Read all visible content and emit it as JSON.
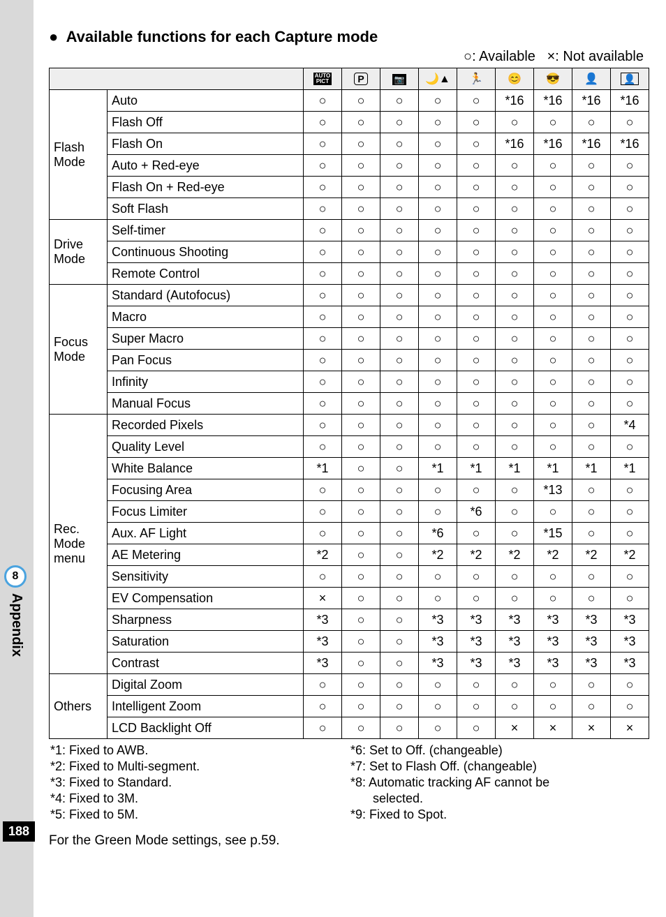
{
  "side": {
    "chapter": "8",
    "label": "Appendix",
    "page": "188"
  },
  "heading": "Available functions for each Capture mode",
  "legend_available": "○: Available",
  "legend_notavailable": "×: Not available",
  "footer_note": "For the Green Mode settings, see p.59.",
  "icons": [
    "AUTO PICT",
    "P",
    "Tv-like",
    "Night",
    "Sport",
    "Face1",
    "Face2",
    "Face3",
    "Frame"
  ],
  "groups": [
    {
      "cat": "Flash Mode",
      "rows": [
        {
          "item": "Auto",
          "v": [
            "○",
            "○",
            "○",
            "○",
            "○",
            "*16",
            "*16",
            "*16",
            "*16"
          ]
        },
        {
          "item": "Flash Off",
          "v": [
            "○",
            "○",
            "○",
            "○",
            "○",
            "○",
            "○",
            "○",
            "○"
          ]
        },
        {
          "item": "Flash On",
          "v": [
            "○",
            "○",
            "○",
            "○",
            "○",
            "*16",
            "*16",
            "*16",
            "*16"
          ]
        },
        {
          "item": "Auto + Red-eye",
          "v": [
            "○",
            "○",
            "○",
            "○",
            "○",
            "○",
            "○",
            "○",
            "○"
          ]
        },
        {
          "item": "Flash On + Red-eye",
          "v": [
            "○",
            "○",
            "○",
            "○",
            "○",
            "○",
            "○",
            "○",
            "○"
          ]
        },
        {
          "item": "Soft Flash",
          "v": [
            "○",
            "○",
            "○",
            "○",
            "○",
            "○",
            "○",
            "○",
            "○"
          ]
        }
      ]
    },
    {
      "cat": "Drive Mode",
      "rows": [
        {
          "item": "Self-timer",
          "v": [
            "○",
            "○",
            "○",
            "○",
            "○",
            "○",
            "○",
            "○",
            "○"
          ]
        },
        {
          "item": "Continuous Shooting",
          "v": [
            "○",
            "○",
            "○",
            "○",
            "○",
            "○",
            "○",
            "○",
            "○"
          ]
        },
        {
          "item": "Remote Control",
          "v": [
            "○",
            "○",
            "○",
            "○",
            "○",
            "○",
            "○",
            "○",
            "○"
          ]
        }
      ]
    },
    {
      "cat": "Focus Mode",
      "rows": [
        {
          "item": "Standard (Autofocus)",
          "v": [
            "○",
            "○",
            "○",
            "○",
            "○",
            "○",
            "○",
            "○",
            "○"
          ]
        },
        {
          "item": "Macro",
          "v": [
            "○",
            "○",
            "○",
            "○",
            "○",
            "○",
            "○",
            "○",
            "○"
          ]
        },
        {
          "item": "Super Macro",
          "v": [
            "○",
            "○",
            "○",
            "○",
            "○",
            "○",
            "○",
            "○",
            "○"
          ]
        },
        {
          "item": "Pan Focus",
          "v": [
            "○",
            "○",
            "○",
            "○",
            "○",
            "○",
            "○",
            "○",
            "○"
          ]
        },
        {
          "item": "Infinity",
          "v": [
            "○",
            "○",
            "○",
            "○",
            "○",
            "○",
            "○",
            "○",
            "○"
          ]
        },
        {
          "item": "Manual Focus",
          "v": [
            "○",
            "○",
            "○",
            "○",
            "○",
            "○",
            "○",
            "○",
            "○"
          ]
        }
      ]
    },
    {
      "cat": "Rec. Mode menu",
      "rows": [
        {
          "item": "Recorded Pixels",
          "v": [
            "○",
            "○",
            "○",
            "○",
            "○",
            "○",
            "○",
            "○",
            "*4"
          ]
        },
        {
          "item": "Quality Level",
          "v": [
            "○",
            "○",
            "○",
            "○",
            "○",
            "○",
            "○",
            "○",
            "○"
          ]
        },
        {
          "item": "White Balance",
          "v": [
            "*1",
            "○",
            "○",
            "*1",
            "*1",
            "*1",
            "*1",
            "*1",
            "*1"
          ]
        },
        {
          "item": "Focusing Area",
          "v": [
            "○",
            "○",
            "○",
            "○",
            "○",
            "○",
            "*13",
            "○",
            "○"
          ]
        },
        {
          "item": "Focus Limiter",
          "v": [
            "○",
            "○",
            "○",
            "○",
            "*6",
            "○",
            "○",
            "○",
            "○"
          ]
        },
        {
          "item": "Aux. AF Light",
          "v": [
            "○",
            "○",
            "○",
            "*6",
            "○",
            "○",
            "*15",
            "○",
            "○"
          ]
        },
        {
          "item": "AE Metering",
          "v": [
            "*2",
            "○",
            "○",
            "*2",
            "*2",
            "*2",
            "*2",
            "*2",
            "*2"
          ]
        },
        {
          "item": "Sensitivity",
          "v": [
            "○",
            "○",
            "○",
            "○",
            "○",
            "○",
            "○",
            "○",
            "○"
          ]
        },
        {
          "item": "EV Compensation",
          "v": [
            "×",
            "○",
            "○",
            "○",
            "○",
            "○",
            "○",
            "○",
            "○"
          ]
        },
        {
          "item": "Sharpness",
          "v": [
            "*3",
            "○",
            "○",
            "*3",
            "*3",
            "*3",
            "*3",
            "*3",
            "*3"
          ]
        },
        {
          "item": "Saturation",
          "v": [
            "*3",
            "○",
            "○",
            "*3",
            "*3",
            "*3",
            "*3",
            "*3",
            "*3"
          ]
        },
        {
          "item": "Contrast",
          "v": [
            "*3",
            "○",
            "○",
            "*3",
            "*3",
            "*3",
            "*3",
            "*3",
            "*3"
          ]
        }
      ]
    },
    {
      "cat": "Others",
      "rows": [
        {
          "item": "Digital Zoom",
          "v": [
            "○",
            "○",
            "○",
            "○",
            "○",
            "○",
            "○",
            "○",
            "○"
          ]
        },
        {
          "item": "Intelligent Zoom",
          "v": [
            "○",
            "○",
            "○",
            "○",
            "○",
            "○",
            "○",
            "○",
            "○"
          ]
        },
        {
          "item": "LCD Backlight Off",
          "v": [
            "○",
            "○",
            "○",
            "○",
            "○",
            "×",
            "×",
            "×",
            "×"
          ]
        }
      ]
    }
  ],
  "notes_left": [
    "*1: Fixed to AWB.",
    "*2: Fixed to Multi-segment.",
    "*3: Fixed to Standard.",
    "*4: Fixed to 3M.",
    "*5: Fixed to 5M."
  ],
  "notes_right": [
    "*6: Set to Off. (changeable)",
    "*7: Set to Flash Off. (changeable)",
    "*8: Automatic tracking AF cannot be",
    "selected.",
    "*9: Fixed to Spot."
  ],
  "chart_data": {
    "type": "table",
    "title": "Available functions for each Capture mode",
    "columns": [
      "AUTO PICT",
      "P",
      "Tv-like",
      "Night",
      "Sport",
      "Face1",
      "Face2",
      "Face3",
      "Frame"
    ],
    "row_groups": [
      "Flash Mode",
      "Drive Mode",
      "Focus Mode",
      "Rec. Mode menu",
      "Others"
    ],
    "rows": [
      "Auto",
      "Flash Off",
      "Flash On",
      "Auto + Red-eye",
      "Flash On + Red-eye",
      "Soft Flash",
      "Self-timer",
      "Continuous Shooting",
      "Remote Control",
      "Standard (Autofocus)",
      "Macro",
      "Super Macro",
      "Pan Focus",
      "Infinity",
      "Manual Focus",
      "Recorded Pixels",
      "Quality Level",
      "White Balance",
      "Focusing Area",
      "Focus Limiter",
      "Aux. AF Light",
      "AE Metering",
      "Sensitivity",
      "EV Compensation",
      "Sharpness",
      "Saturation",
      "Contrast",
      "Digital Zoom",
      "Intelligent Zoom",
      "LCD Backlight Off"
    ]
  }
}
